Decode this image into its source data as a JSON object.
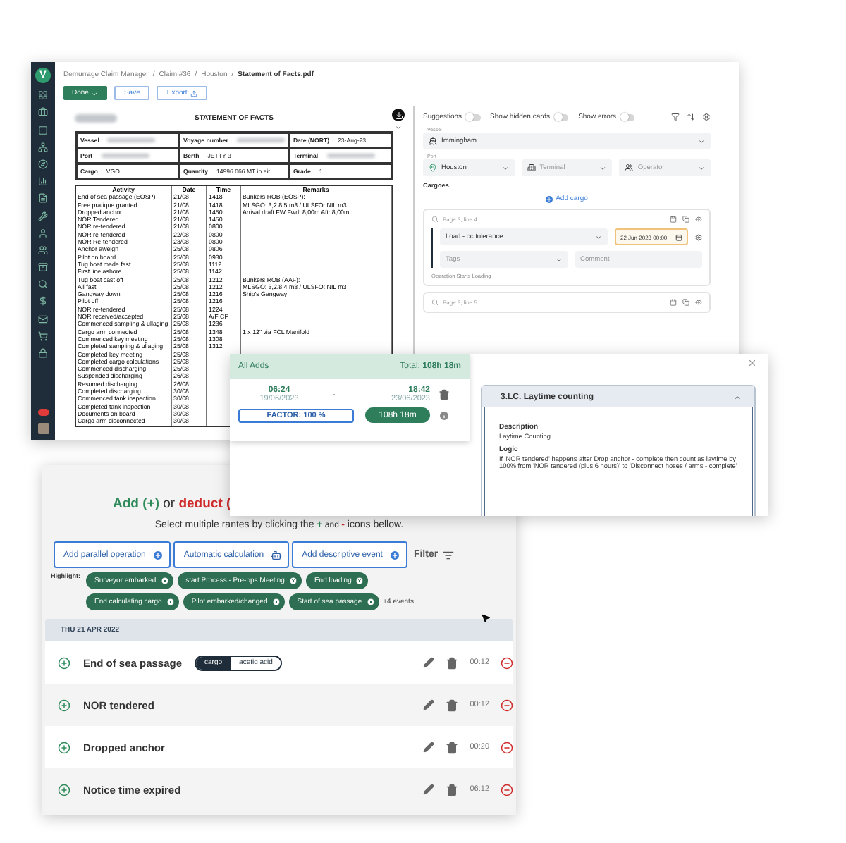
{
  "app": {
    "logo": "V",
    "breadcrumb": [
      "Demurrage Claim Manager",
      "Claim #36",
      "Houston"
    ],
    "breadcrumb_separator": "/",
    "breadcrumb_current": "Statement of Facts.pdf",
    "buttons": [
      {
        "label": "Done",
        "kind": "primary"
      },
      {
        "label": "Save",
        "kind": "outline"
      },
      {
        "label": "Export",
        "kind": "export"
      }
    ]
  },
  "document": {
    "title": "STATEMENT OF FACTS",
    "header_cells": [
      {
        "label": "Vessel",
        "redacted": true
      },
      {
        "label": "Voyage number",
        "redacted": true
      },
      {
        "label": "Date (NORT)",
        "value": "23-Aug-23"
      },
      {
        "label": "Port",
        "redacted": true
      },
      {
        "label": "Berth",
        "value": "JETTY 3"
      },
      {
        "label": "Terminal",
        "redacted": true
      },
      {
        "label": "Cargo",
        "value": "VGO"
      },
      {
        "label": "Quantity",
        "value": "14996.066 MT in air"
      },
      {
        "label": "Grade",
        "value": "1"
      }
    ],
    "columns": [
      "Activity",
      "Date",
      "Time",
      "Remarks"
    ],
    "rows": [
      {
        "activity": "End of sea passage (EOSP)",
        "date": "21/08",
        "time": "1418",
        "remarks": "Bunkers ROB (EOSP):"
      },
      {
        "activity": "Free pratique granted",
        "date": "21/08",
        "time": "1418",
        "remarks": "MLSGO: 3,2.8,5 m3 / ULSFO: NIL m3"
      },
      {
        "activity": "Dropped anchor",
        "date": "21/08",
        "time": "1450",
        "remarks": "Arrival draft FW Fwd: 8,00m Aft: 8,00m"
      },
      {
        "activity": "NOR Tendered",
        "date": "21/08",
        "time": "1450"
      },
      {
        "activity": "NOR re-tendered",
        "date": "21/08",
        "time": "0800"
      },
      {
        "activity": "NOR re-tendered",
        "date": "22/08",
        "time": "0800"
      },
      {
        "activity": "NOR Re-tendered",
        "date": "23/08",
        "time": "0800"
      },
      {
        "activity": "Anchor aweigh",
        "date": "25/08",
        "time": "0806"
      },
      {
        "activity": "Pilot on board",
        "date": "25/08",
        "time": "0930"
      },
      {
        "activity": "Tug boat made fast",
        "date": "25/08",
        "time": "1112"
      },
      {
        "activity": "First line ashore",
        "date": "25/08",
        "time": "1142"
      },
      {
        "activity": "Tug boat cast off",
        "date": "25/08",
        "time": "1212",
        "remarks": "Bunkers ROB (AAF):"
      },
      {
        "activity": "All fast",
        "date": "25/08",
        "time": "1212",
        "remarks": "MLSGO: 3,2.8,4 m3 / ULSFO: NIL m3"
      },
      {
        "activity": "Gangway down",
        "date": "25/08",
        "time": "1216",
        "remarks": "Ship's Gangway"
      },
      {
        "activity": "Pilot off",
        "date": "25/08",
        "time": "1216"
      },
      {
        "activity": "NOR re-tendered",
        "date": "25/08",
        "time": "1224"
      },
      {
        "activity": "NOR received/accepted",
        "date": "25/08",
        "time": "A/F CP"
      },
      {
        "activity": "Commenced sampling & ullaging",
        "date": "25/08",
        "time": "1236"
      },
      {
        "activity": "Cargo arm connected",
        "date": "25/08",
        "time": "1348",
        "remarks": "1 x 12\" via FCL Manifold"
      },
      {
        "activity": "Commenced key meeting",
        "date": "25/08",
        "time": "1308"
      },
      {
        "activity": "Completed sampling & ullaging",
        "date": "25/08",
        "time": "1312"
      },
      {
        "activity": "Completed key meeting",
        "date": "25/08"
      },
      {
        "activity": "Completed cargo calculations",
        "date": "25/08"
      },
      {
        "activity": "Commenced discharging",
        "date": "25/08"
      },
      {
        "activity": "Suspended discharging",
        "date": "26/08"
      },
      {
        "activity": "Resumed discharging",
        "date": "26/08"
      },
      {
        "activity": "Completed discharging",
        "date": "30/08"
      },
      {
        "activity": "Commenced tank inspection",
        "date": "30/08"
      },
      {
        "activity": "Completed tank inspection",
        "date": "30/08"
      },
      {
        "activity": "Documents on board",
        "date": "30/08"
      },
      {
        "activity": "Cargo arm disconnected",
        "date": "30/08"
      }
    ]
  },
  "side_panel": {
    "toggles": [
      {
        "label": "Suggestions",
        "on": false
      },
      {
        "label": "Show hidden cards",
        "on": false
      },
      {
        "label": "Show errors",
        "on": false
      }
    ],
    "vessel": {
      "label": "Vessel",
      "value": "Immingham"
    },
    "port": {
      "label": "Port",
      "value": "Houston"
    },
    "terminal": {
      "placeholder": "Terminal"
    },
    "operator": {
      "placeholder": "Operator"
    },
    "cargoes_label": "Cargoes",
    "add_cargo": "Add cargo",
    "cards": [
      {
        "source": "Page 3, line 4",
        "event": "Load - cc tolerance",
        "date": "22 Jun 2023 00:00",
        "tags": {
          "placeholder": "Tags"
        },
        "comment": {
          "placeholder": "Comment"
        },
        "note": "Operation Starts Loading"
      },
      {
        "source": "Page 3, line 5"
      }
    ]
  },
  "period_card": {
    "title": "All Adds",
    "total": "Total: **108h 18m**",
    "start_time": "06:24",
    "start_date": "19/06/2023",
    "separator": "-",
    "end_time": "18:42",
    "end_date": "23/06/2023",
    "factor": "FACTOR: 100 %",
    "duration": "108h 18m"
  },
  "rule_card": {
    "title": "3.LC. Laytime counting",
    "expanded": true,
    "description_label": "Description",
    "description": "Laytime Counting",
    "logic_label": "Logic",
    "logic": "If 'NOR tendered' happens after Drop anchor - complete then count as laytime by 100% from 'NOR tendered (plus 6 hours)' to 'Disconnect hoses / arms - complete'"
  },
  "events_panel": {
    "heading": [
      {
        "text": "Add (+)",
        "kind": "add"
      },
      {
        "text": " or ",
        "kind": "plain"
      },
      {
        "text": "deduct (",
        "kind": "deduct"
      }
    ],
    "subtitle": [
      {
        "text": "Select multiple rantes by clicking the ",
        "kind": "plain"
      },
      {
        "text": "+",
        "kind": "add"
      },
      {
        "text": " and ",
        "kind": "small"
      },
      {
        "text": "-",
        "kind": "deduct"
      },
      {
        "text": " icons bellow.",
        "kind": "plain"
      }
    ],
    "actions": [
      {
        "label": "Add parallel operation",
        "kind": "add"
      },
      {
        "label": "Automatic calculation",
        "kind": "robot"
      },
      {
        "label": "Add descriptive event",
        "kind": "add"
      }
    ],
    "filter": "Filter",
    "highlight_label": "Highlight:",
    "highlights": [
      "Surveyor embarked",
      "start Process - Pre-ops Meeting",
      "End loading",
      "End calculating cargo",
      "Pilot embarked/changed",
      "Start of sea passage"
    ],
    "more": "+4 events",
    "date": "THU 21 APR 2022",
    "events": [
      {
        "name": "End of sea passage",
        "tags": [
          {
            "label": "cargo",
            "kind": "dark"
          },
          {
            "label": "acetig acid",
            "kind": "light"
          }
        ],
        "time": "00:12"
      },
      {
        "name": "NOR tendered",
        "time": "00:12"
      },
      {
        "name": "Dropped anchor",
        "time": "00:20"
      },
      {
        "name": "Notice time expired",
        "time": "06:12"
      }
    ]
  }
}
